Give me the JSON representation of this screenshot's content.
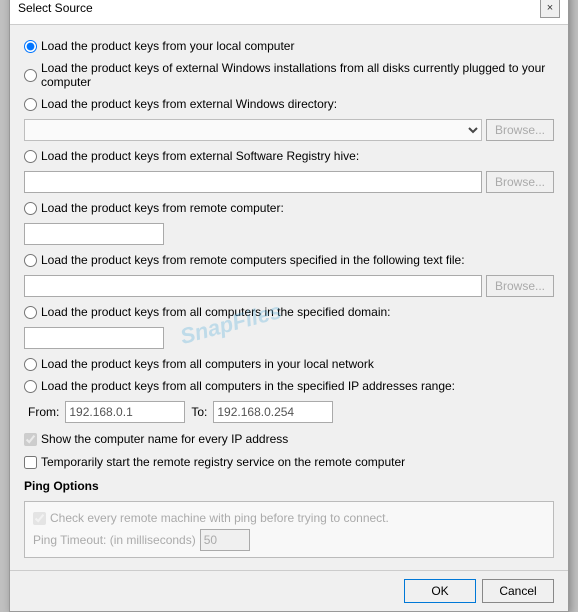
{
  "dialog": {
    "title": "Select Source",
    "close_icon": "×"
  },
  "options": {
    "radio1_label": "Load the product keys from your local computer",
    "radio2_label": "Load the product keys of external Windows installations from all disks currently plugged to your computer",
    "radio3_label": "Load the product keys from external Windows directory:",
    "radio3_browse": "Browse...",
    "radio3_placeholder": "",
    "radio4_label": "Load the product keys from external Software Registry hive:",
    "radio4_browse": "Browse...",
    "radio5_label": "Load the product keys from remote computer:",
    "radio6_label": "Load the product keys from remote computers specified in the following text file:",
    "radio6_browse": "Browse...",
    "radio7_label": "Load the product keys from all computers in the specified domain:",
    "radio8_label": "Load the product keys from all computers in your local network",
    "radio9_label": "Load the product keys from all computers in the specified IP addresses range:",
    "from_label": "From:",
    "from_value": "192.168.0.1",
    "to_label": "To:",
    "to_value": "192.168.0.254",
    "check1_label": "Show the computer name for every IP address",
    "check2_label": "Temporarily start the remote registry service on the remote computer",
    "ping_section": "Ping Options",
    "ping_check_label": "Check every remote machine with ping before trying to connect.",
    "ping_timeout_label": "Ping Timeout: (in milliseconds)",
    "ping_timeout_value": "50"
  },
  "footer": {
    "ok_label": "OK",
    "cancel_label": "Cancel"
  },
  "watermark": "SnapFiles"
}
